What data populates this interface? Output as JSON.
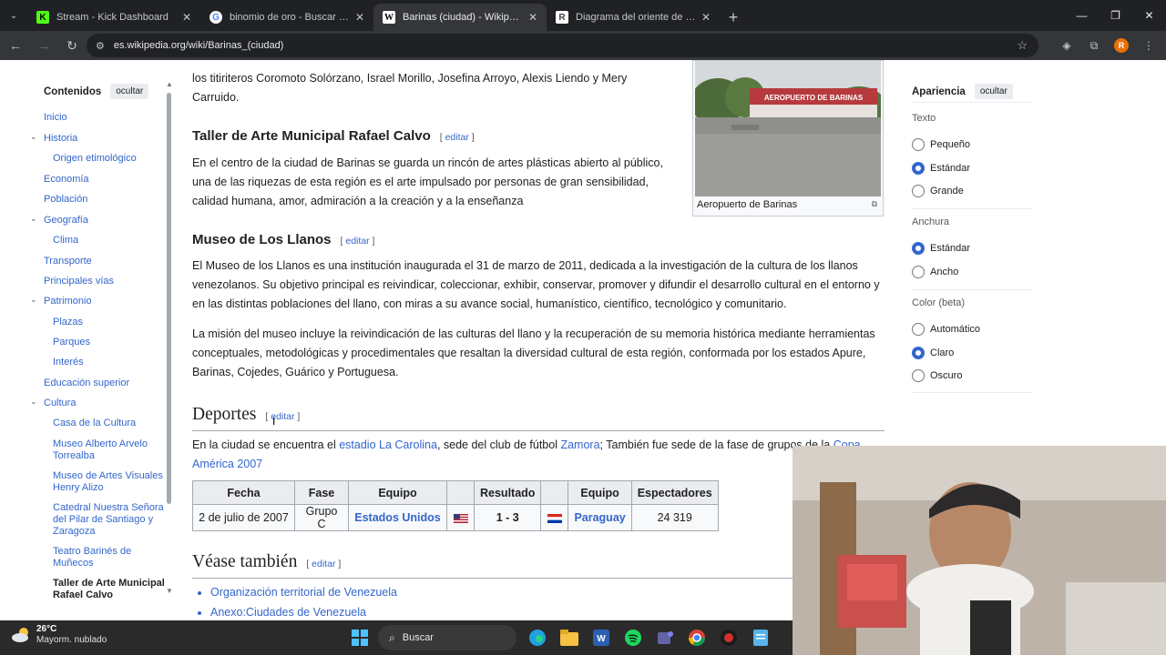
{
  "browser": {
    "tabs": [
      {
        "title": "Stream - Kick Dashboard",
        "icon": "kick-icon",
        "active": false
      },
      {
        "title": "binomio de oro - Buscar con Google",
        "icon": "google-icon",
        "active": false
      },
      {
        "title": "Barinas (ciudad) - Wikipedia, la enciclopedia libre",
        "icon": "wikipedia-icon",
        "active": true
      },
      {
        "title": "Diagrama del oriente de Venezuela",
        "icon": "r-icon",
        "active": false
      }
    ],
    "url": "es.wikipedia.org/wiki/Barinas_(ciudad)",
    "profile_initial": "R"
  },
  "toc": {
    "title": "Contenidos",
    "hide": "ocultar",
    "items": [
      {
        "label": "Inicio"
      },
      {
        "label": "Historia"
      },
      {
        "label": "Origen etimológico"
      },
      {
        "label": "Economía"
      },
      {
        "label": "Población"
      },
      {
        "label": "Geografía"
      },
      {
        "label": "Clima"
      },
      {
        "label": "Transporte"
      },
      {
        "label": "Principales vías"
      },
      {
        "label": "Patrimonio"
      },
      {
        "label": "Plazas"
      },
      {
        "label": "Parques"
      },
      {
        "label": "Interés"
      },
      {
        "label": "Educación superior"
      },
      {
        "label": "Cultura"
      },
      {
        "label": "Casa de la Cultura"
      },
      {
        "label": "Museo Alberto Arvelo Torrealba"
      },
      {
        "label": "Museo de Artes Visuales Henry Alizo"
      },
      {
        "label": "Catedral Nuestra Señora del Pilar de Santiago y Zaragoza"
      },
      {
        "label": "Teatro Barinés de Muñecos"
      },
      {
        "label": "Taller de Arte Municipal Rafael Calvo"
      }
    ]
  },
  "article": {
    "intro_fragment": "los titiriteros Coromoto Solórzano, Israel Morillo, Josefina Arroyo, Alexis Liendo y Mery Carruido.",
    "edit": "editar",
    "taller_heading": "Taller de Arte Municipal Rafael Calvo",
    "taller_text": "En el centro de la ciudad de Barinas se guarda un rincón de artes plásticas abierto al público, una de las riquezas de esta región es el arte impulsado por personas de gran sensibilidad, calidad humana, amor, admiración a la creación y a la enseñanza",
    "museo_heading": "Museo de Los Llanos",
    "museo_text1": "El Museo de los Llanos es una institución inaugurada el 31 de marzo de 2011, dedicada a la investigación de la cultura de los llanos venezolanos. Su objetivo principal es reivindicar, coleccionar, exhibir, conservar, promover y difundir el desarrollo cultural en el entorno y en las distintas poblaciones del llano, con miras a su avance social, humanístico, científico, tecnológico y comunitario.",
    "museo_text2": "La misión del museo incluye la reivindicación de las culturas del llano y la recuperación de su memoria histórica mediante herramientas conceptuales, metodológicas y procedimentales que resaltan la diversidad cultural de esta región, conformada por los estados Apure, Barinas, Cojedes, Guárico y Portuguesa.",
    "deportes_heading": "Deportes",
    "deportes_pre": "En la ciudad se encuentra el ",
    "deportes_link1": "estadio La Carolina",
    "deportes_mid": ", sede del club de fútbol ",
    "deportes_link2": "Zamora",
    "deportes_post": "; También fue sede de la fase de grupos de la ",
    "deportes_link3": "Copa América 2007",
    "image_caption": "Aeropuerto de Barinas",
    "image_sign": "AEROPUERTO DE BARINAS",
    "table": {
      "headers": [
        "Fecha",
        "Fase",
        "Equipo",
        "",
        "Resultado",
        "",
        "Equipo",
        "Espectadores"
      ],
      "row": {
        "fecha": "2 de julio de 2007",
        "fase": "Grupo C",
        "equipo1": "Estados Unidos",
        "resultado": "1 - 3",
        "equipo2": "Paraguay",
        "espectadores": "24 319"
      }
    },
    "vease_heading": "Véase también",
    "vease_items": [
      "Organización territorial de Venezuela",
      "Anexo:Ciudades de Venezuela"
    ]
  },
  "appearance": {
    "title": "Apariencia",
    "hide": "ocultar",
    "texto_label": "Texto",
    "texto_options": [
      "Pequeño",
      "Estándar",
      "Grande"
    ],
    "texto_selected": 1,
    "anchura_label": "Anchura",
    "anchura_options": [
      "Estándar",
      "Ancho"
    ],
    "anchura_selected": 0,
    "color_label": "Color (beta)",
    "color_options": [
      "Automático",
      "Claro",
      "Oscuro"
    ],
    "color_selected": 1
  },
  "taskbar": {
    "temp": "26°C",
    "weather": "Mayorm. nublado",
    "search": "Buscar"
  }
}
